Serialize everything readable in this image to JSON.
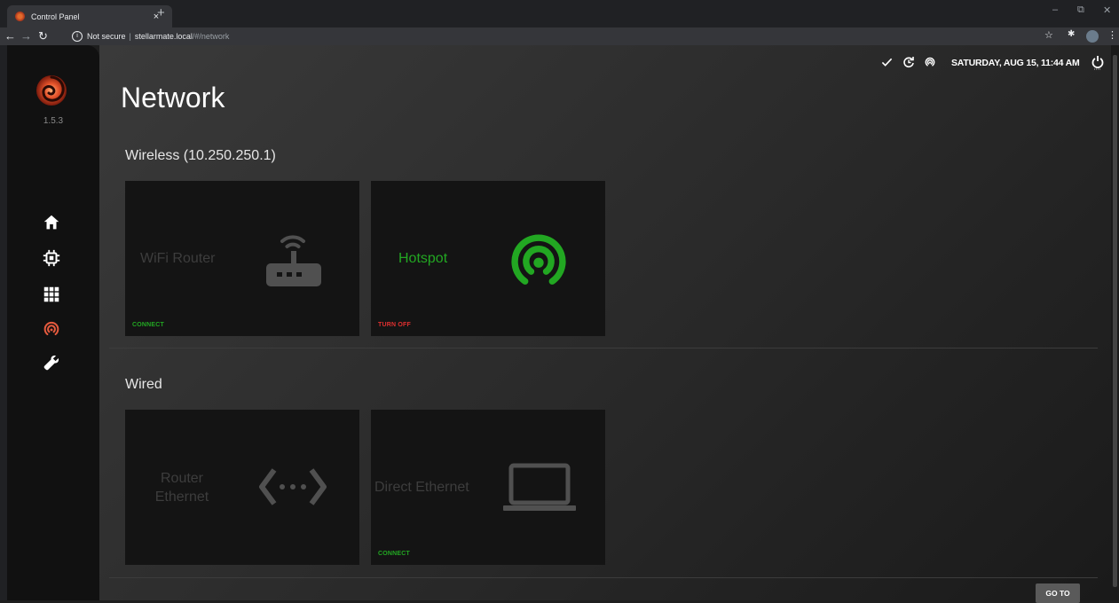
{
  "browser": {
    "tab_title": "Control Panel",
    "tab_close": "×",
    "new_tab": "+",
    "security_label": "Not secure",
    "url_host": "stellarmate.local",
    "url_path": "/#/network",
    "window_controls": {
      "minimize": "–",
      "restore": "⧉",
      "close": "✕"
    }
  },
  "sidebar": {
    "version": "1.5.3",
    "items": [
      {
        "name": "home",
        "icon": "home-icon",
        "active": false
      },
      {
        "name": "devices",
        "icon": "chip-icon",
        "active": false
      },
      {
        "name": "apps",
        "icon": "grid-icon",
        "active": false
      },
      {
        "name": "network",
        "icon": "hotspot-icon",
        "active": true
      },
      {
        "name": "tools",
        "icon": "wrench-icon",
        "active": false
      }
    ]
  },
  "header": {
    "title": "Network",
    "datetime": "SATURDAY, AUG 15, 11:44 AM",
    "status_icons": [
      "check-icon",
      "refresh-icon",
      "hotspot-icon"
    ],
    "power_icon": "power-icon"
  },
  "sections": {
    "wireless": {
      "label": "Wireless (10.250.250.1)",
      "cards": [
        {
          "label": "WiFi Router",
          "action": "CONNECT",
          "icon": "router-icon",
          "active": false
        },
        {
          "label": "Hotspot",
          "action": "TURN OFF",
          "icon": "hotspot-icon",
          "active": true
        }
      ]
    },
    "wired": {
      "label": "Wired",
      "cards": [
        {
          "label": "Router Ethernet",
          "action": "",
          "icon": "ethernet-icon",
          "active": false
        },
        {
          "label": "Direct Ethernet",
          "action": "CONNECT",
          "icon": "laptop-icon",
          "active": false
        }
      ]
    }
  },
  "footer": {
    "goto_label": "GO TO"
  },
  "colors": {
    "accent_green": "#22a722",
    "danger_red": "#e03030",
    "active_nav": "#e55a3e",
    "inactive_text": "#3d3d3d"
  }
}
